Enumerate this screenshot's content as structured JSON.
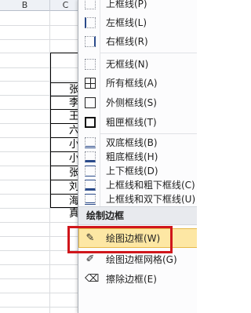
{
  "spreadsheet": {
    "column_b": "B",
    "column_c_partial": "C",
    "cell_chars": [
      "张",
      "李",
      "王",
      "六",
      "小",
      "小",
      "张",
      "刘",
      "海",
      "真"
    ]
  },
  "menu": {
    "items_top": [
      {
        "label": "上框线(P)",
        "icon": "top-border-icon"
      },
      {
        "label": "左框线(L)",
        "icon": "left-border-icon"
      },
      {
        "label": "右框线(R)",
        "icon": "right-border-icon"
      }
    ],
    "items_mid": [
      {
        "label": "无框线(N)",
        "icon": "no-border-icon"
      },
      {
        "label": "所有框线(A)",
        "icon": "all-borders-icon"
      },
      {
        "label": "外侧框线(S)",
        "icon": "outside-borders-icon"
      },
      {
        "label": "粗匣框线(T)",
        "icon": "thick-box-border-icon"
      }
    ],
    "items_lower": [
      {
        "label": "双底框线(B)",
        "icon": "double-bottom-border-icon"
      },
      {
        "label": "粗底框线(H)",
        "icon": "thick-bottom-border-icon"
      },
      {
        "label": "上下框线(D)",
        "icon": "top-bottom-border-icon"
      },
      {
        "label": "上框线和粗下框线(C)",
        "icon": "top-thick-bottom-border-icon"
      },
      {
        "label": "上框线和双下框线(U)",
        "icon": "top-double-bottom-border-icon"
      }
    ],
    "section_title": "绘制边框",
    "draw_items": [
      {
        "label": "绘图边框(W)",
        "icon": "draw-border-pencil-icon",
        "highlighted": true
      },
      {
        "label": "绘图边框网格(G)",
        "icon": "draw-border-grid-icon"
      },
      {
        "label": "擦除边框(E)",
        "icon": "eraser-icon"
      }
    ]
  },
  "colors": {
    "highlight_fill": "#fde7a4",
    "annotation_box": "#d0161b"
  }
}
